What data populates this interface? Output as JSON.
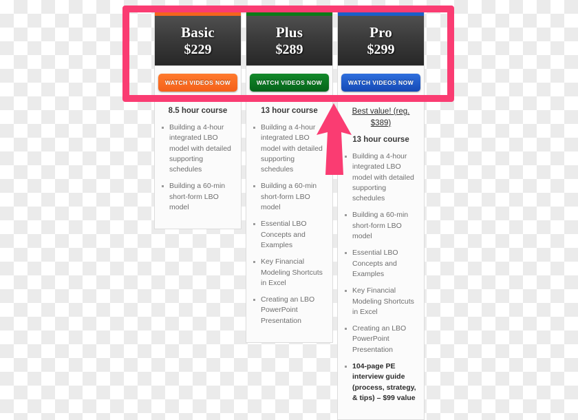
{
  "annotation": {
    "highlight_color": "#fa3c72",
    "arrow_color": "#fa3c72",
    "highlight_label": "highlight-rectangle-around-plans-and-buttons",
    "arrow_label": "up-arrow-pointing-to-pro-button"
  },
  "plans": [
    {
      "id": "basic",
      "name": "Basic",
      "price": "$229",
      "accent": "#f4641e",
      "cta": "WATCH VIDEOS NOW",
      "best_value": "",
      "course": "8.5 hour course",
      "features": [
        {
          "text": "Building a 4-hour integrated LBO model with detailed supporting schedules",
          "bold": false
        },
        {
          "text": "Building a 60-min short-form LBO model",
          "bold": false
        }
      ]
    },
    {
      "id": "plus",
      "name": "Plus",
      "price": "$289",
      "accent": "#0b7a18",
      "cta": "WATCH VIDEOS NOW",
      "best_value": "",
      "course": "13 hour course",
      "features": [
        {
          "text": "Building a 4-hour integrated LBO model with detailed supporting schedules",
          "bold": false
        },
        {
          "text": "Building a 60-min short-form LBO model",
          "bold": false
        },
        {
          "text": "Essential LBO Concepts and Examples",
          "bold": false
        },
        {
          "text": "Key Financial Modeling Shortcuts in Excel",
          "bold": false
        },
        {
          "text": "Creating an LBO PowerPoint Presentation",
          "bold": false
        }
      ]
    },
    {
      "id": "pro",
      "name": "Pro",
      "price": "$299",
      "accent": "#1b5fc8",
      "cta": "WATCH VIDEOS NOW",
      "best_value": "Best value! (reg. $389)",
      "course": "13 hour course",
      "features": [
        {
          "text": "Building a 4-hour integrated LBO model with detailed supporting schedules",
          "bold": false
        },
        {
          "text": "Building a 60-min short-form LBO model",
          "bold": false
        },
        {
          "text": "Essential LBO Concepts and Examples",
          "bold": false
        },
        {
          "text": "Key Financial Modeling Shortcuts in Excel",
          "bold": false
        },
        {
          "text": "Creating an LBO PowerPoint Presentation",
          "bold": false
        },
        {
          "text": "104-page PE interview guide (process, strategy, & tips) – $99 value",
          "bold": true
        }
      ]
    }
  ]
}
